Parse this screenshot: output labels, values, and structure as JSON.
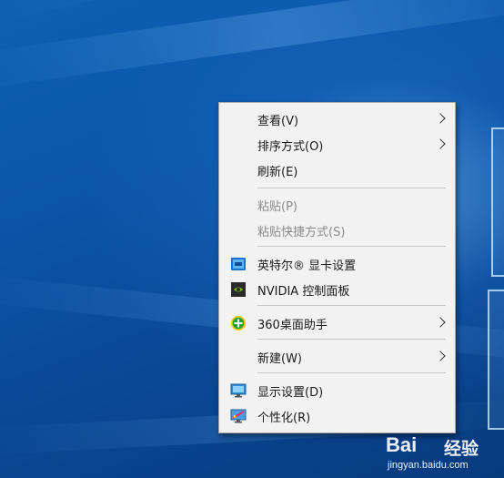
{
  "desktop": {
    "background": "windows-10-blue-light-wallpaper"
  },
  "context_menu": {
    "items": [
      {
        "label": "查看(V)",
        "has_submenu": true,
        "enabled": true,
        "icon": ""
      },
      {
        "label": "排序方式(O)",
        "has_submenu": true,
        "enabled": true,
        "icon": ""
      },
      {
        "label": "刷新(E)",
        "has_submenu": false,
        "enabled": true,
        "icon": ""
      },
      {
        "label": "粘贴(P)",
        "has_submenu": false,
        "enabled": false,
        "icon": ""
      },
      {
        "label": "粘贴快捷方式(S)",
        "has_submenu": false,
        "enabled": false,
        "icon": ""
      },
      {
        "label": "英特尔® 显卡设置",
        "has_submenu": false,
        "enabled": true,
        "icon": "intel-graphics-icon"
      },
      {
        "label": "NVIDIA 控制面板",
        "has_submenu": false,
        "enabled": true,
        "icon": "nvidia-icon"
      },
      {
        "label": "360桌面助手",
        "has_submenu": true,
        "enabled": true,
        "icon": "360-icon"
      },
      {
        "label": "新建(W)",
        "has_submenu": true,
        "enabled": true,
        "icon": ""
      },
      {
        "label": "显示设置(D)",
        "has_submenu": false,
        "enabled": true,
        "icon": "display-settings-icon"
      },
      {
        "label": "个性化(R)",
        "has_submenu": false,
        "enabled": true,
        "icon": "personalize-icon"
      }
    ]
  },
  "watermark": {
    "brand": "Bai",
    "brand_suffix": "经验",
    "url": "jingyan.baidu.com"
  },
  "colors": {
    "menu_bg": "#f2f2f2",
    "separator": "#c8c8c8",
    "text": "#1a1a1a",
    "disabled_text": "#8a8a8a",
    "desktop_blue": "#0a4c9c"
  }
}
